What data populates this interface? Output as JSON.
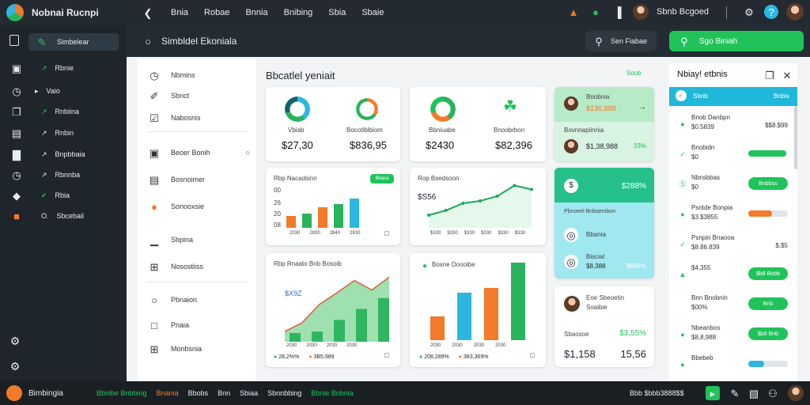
{
  "app": {
    "name": "Nobnai Rucnpi"
  },
  "topnav": [
    "Bnia",
    "Robae",
    "Bnnia",
    "Bnibing",
    "Sbia",
    "Sbaie"
  ],
  "topright": {
    "user": "Sbnb Bcgoed"
  },
  "sidebar": {
    "items": [
      {
        "label": "Simbelear",
        "icon": "grid-icon"
      },
      {
        "label": "Rbnie",
        "icon": "chart-icon"
      },
      {
        "label": "Vaio",
        "icon": "clock-icon"
      },
      {
        "label": "Rnbiina",
        "icon": "link-icon"
      },
      {
        "label": "Rnbin",
        "icon": "archive-icon"
      },
      {
        "label": "Bnpbbaia",
        "icon": "bar-chart-icon"
      },
      {
        "label": "Rbnnba",
        "icon": "clock-icon"
      },
      {
        "label": "Rbia",
        "icon": "shield-icon"
      },
      {
        "label": "Sbcebail",
        "icon": "document-icon"
      }
    ],
    "bottom_icons": [
      "settings-icon",
      "gear-icon"
    ]
  },
  "header": {
    "title": "Simbldel Ekoniala",
    "search_label": "Sen Fiabae",
    "primary_button": "Sgo Biniah"
  },
  "left_panel": {
    "items": [
      {
        "label": "Nbmins",
        "icon": "clock-icon"
      },
      {
        "label": "Sbrict",
        "icon": "edit-icon"
      },
      {
        "label": "Nabosnis",
        "icon": "checkbox-icon"
      },
      {
        "label": "Beoer Bonih",
        "icon": "document-icon"
      },
      {
        "label": "Bosnoimer",
        "icon": "doc-icon"
      },
      {
        "label": "Sonooxsie",
        "icon": "lightbulb-icon"
      },
      {
        "label": "Sbpina",
        "icon": "chart-icon"
      },
      {
        "label": "Nosostiiss",
        "icon": "grid-icon"
      },
      {
        "label": "Pbnaion",
        "icon": "circle-icon"
      },
      {
        "label": "Pnaia",
        "icon": "square-icon"
      },
      {
        "label": "Monbsnia",
        "icon": "table-icon"
      }
    ]
  },
  "section": {
    "title": "Bbcatlel yeniait"
  },
  "stats": [
    {
      "left_label": "Vbiab",
      "left_value": "$27,30",
      "right_label": "Bocotiblbiom",
      "right_value": "$836,95"
    },
    {
      "left_label": "Bbniuabe",
      "left_value": "$2430",
      "right_label": "Bnoobrbon",
      "right_value": "$82,396"
    }
  ],
  "charts": {
    "bar1": {
      "title": "Rbp Nacadsinn",
      "badge": "Bbasa",
      "ylabels": [
        "00",
        "26",
        "20",
        "08"
      ],
      "xlabels": [
        "2030",
        "2830",
        "2840",
        "2830"
      ],
      "bars": [
        {
          "height": 0.28,
          "color": "#f27a2a"
        },
        {
          "height": 0.34,
          "color": "#29b35c"
        },
        {
          "height": 0.5,
          "color": "#f27a2a"
        },
        {
          "height": 0.58,
          "color": "#29b35c"
        },
        {
          "height": 0.72,
          "color": "#2bb7e0"
        }
      ]
    },
    "line1": {
      "title": "Rop Bsedsoon",
      "value": "$S56",
      "xlabels": [
        "$330",
        "$330",
        "$330",
        "$330",
        "$330",
        "$330",
        "$330"
      ],
      "points": [
        0.2,
        0.32,
        0.5,
        0.56,
        0.68,
        0.95,
        0.85
      ]
    },
    "area1": {
      "title": "Rbp Rnaato Bnb Bosoib",
      "value": "$X9Z",
      "xlabels": [
        "2030",
        "2030",
        "2030",
        "2030",
        "2030"
      ],
      "legend": [
        {
          "label": "28,2%%",
          "color": "#29b35c"
        },
        {
          "label": "3B5,989",
          "color": "#f27a2a"
        }
      ],
      "points": [
        0.15,
        0.28,
        0.55,
        0.72,
        0.9,
        0.76,
        0.95
      ]
    },
    "bar2": {
      "title": "Bosne Doooibe",
      "xlabels": [
        "2030",
        "2030",
        "2030",
        "2030",
        "2030"
      ],
      "legend": [
        {
          "label": "208,289%",
          "color": "#29b35c"
        },
        {
          "label": "383,369%",
          "color": "#f27a2a"
        }
      ],
      "bars": [
        {
          "height": 0.3,
          "color": "#f27a2a"
        },
        {
          "height": 0.6,
          "color": "#2bb7e0"
        },
        {
          "height": 0.66,
          "color": "#f27a2a"
        },
        {
          "height": 0.98,
          "color": "#29b35c"
        }
      ]
    }
  },
  "mid_cards": {
    "c1": {
      "name": "Bnobnia",
      "value": "$136,888",
      "bottom_label": "Bovnnapiinnia",
      "bottom_value": "$1,38,988",
      "pct": "33%"
    },
    "c2": {
      "value": "$288%",
      "label": "Pbnoeel Bnbsembon",
      "r1": "Bbania",
      "r2": "Biscial",
      "r2v": "$8,388",
      "pct": "$888%"
    },
    "c3": {
      "name": "Eoe Sbeoetin",
      "sub": "Soaibie",
      "pct": "$3,55%",
      "left": "Sbaosoe",
      "bottom_left": "$1,158",
      "bottom_right": "15,56"
    }
  },
  "right_panel": {
    "title": "Nbiay! etbnis",
    "head": {
      "left": "Sbnb",
      "right": "Bnbis"
    },
    "rows": [
      {
        "name": "Bnob Danbpn",
        "value": "$0.5839",
        "right": "$$8.$99",
        "kind": "text"
      },
      {
        "name": "Bnobidn",
        "value": "$0",
        "kind": "bar",
        "fill": 0.95,
        "color": "#1fc35a"
      },
      {
        "name": "Nbnsbbas",
        "value": "$0",
        "kind": "pill",
        "pill": "Bnbbos"
      },
      {
        "name": "Psntde Bonpia",
        "value": "$3.$3855",
        "kind": "bar",
        "fill": 0.6,
        "color": "#f27a2a"
      },
      {
        "name": "Psnpin Bnaooa",
        "value": "$8.86.839",
        "right": "$.$5",
        "kind": "text"
      },
      {
        "name": "$4,355",
        "value": "",
        "kind": "pill",
        "pill": "$b8 Bobb"
      },
      {
        "name": "Bnn Bnobnin",
        "value": "$00%",
        "kind": "pill",
        "pill": "Bnb"
      },
      {
        "name": "Nbeanbos",
        "value": "$8,8,988",
        "kind": "pill",
        "pill": "$b8 Bnb"
      },
      {
        "name": "Bbebeb",
        "value": "",
        "kind": "bar",
        "fill": 0.4,
        "color": "#2bb7e0"
      }
    ]
  },
  "bottom": {
    "app": "Bimbingia",
    "items": [
      "Bbnibe Bnbbing",
      "Bnania",
      "Bbobs",
      "Bnn",
      "Sbiaa",
      "Sbnnbbing",
      "Bbnie Bobnia"
    ],
    "right": "Bbb $bbb3888$$"
  }
}
